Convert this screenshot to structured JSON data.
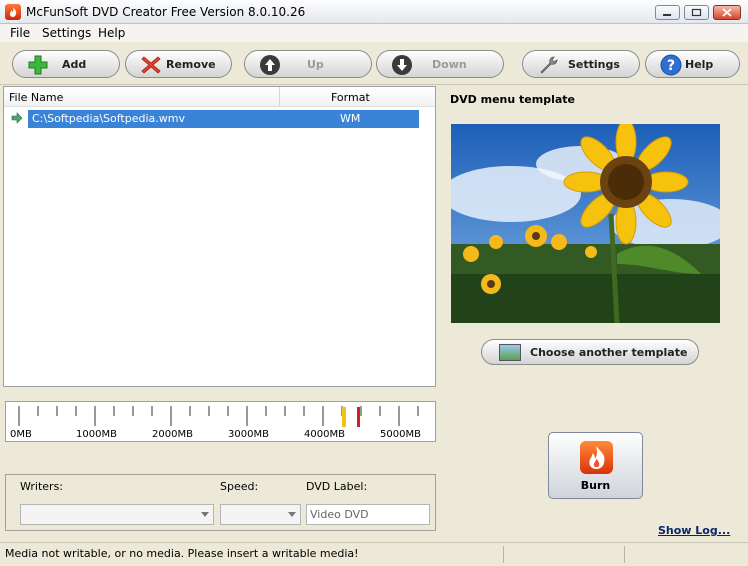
{
  "window": {
    "title": "McFunSoft DVD Creator Free Version 8.0.10.26"
  },
  "menu": [
    "File",
    "Settings",
    "Help"
  ],
  "toolbar": {
    "add": "Add",
    "remove": "Remove",
    "up": "Up",
    "down": "Down",
    "settings": "Settings",
    "help": "Help"
  },
  "filelist": {
    "col_name": "File Name",
    "col_format": "Format",
    "rows": [
      {
        "name": "C:\\Softpedia\\Softpedia.wmv",
        "format": "WM"
      }
    ]
  },
  "template": {
    "label": "DVD menu template",
    "choose_button": "Choose another template"
  },
  "ruler": {
    "labels": [
      "0MB",
      "1000MB",
      "2000MB",
      "3000MB",
      "4000MB",
      "5000MB"
    ]
  },
  "writers": {
    "writers_label": "Writers:",
    "speed_label": "Speed:",
    "dvd_label_label": "DVD Label:",
    "dvd_label_value": "Video DVD"
  },
  "burn": {
    "label": "Burn"
  },
  "show_log": "Show Log...",
  "status": {
    "message": "Media not writable, or no media. Please insert a writable media!"
  }
}
